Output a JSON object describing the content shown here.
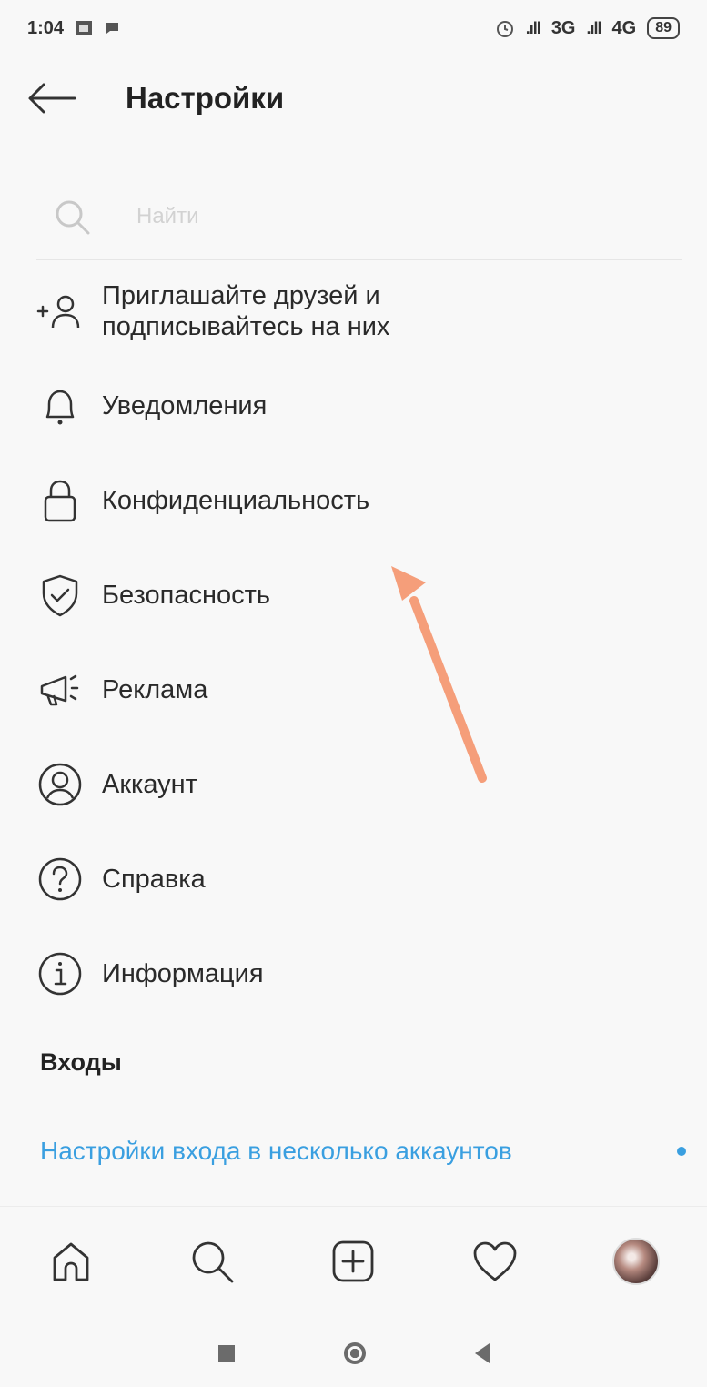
{
  "status_bar": {
    "time": "1:04",
    "network1": "3G",
    "network2": "4G",
    "battery": "89"
  },
  "header": {
    "title": "Настройки"
  },
  "search": {
    "placeholder": "Найти"
  },
  "menu": {
    "items": [
      {
        "label": "Приглашайте друзей и подписывайтесь на них",
        "icon": "add-person-icon"
      },
      {
        "label": "Уведомления",
        "icon": "bell-icon"
      },
      {
        "label": "Конфиденциальность",
        "icon": "lock-icon"
      },
      {
        "label": "Безопасность",
        "icon": "shield-check-icon"
      },
      {
        "label": "Реклама",
        "icon": "megaphone-icon"
      },
      {
        "label": "Аккаунт",
        "icon": "user-circle-icon"
      },
      {
        "label": "Справка",
        "icon": "help-circle-icon"
      },
      {
        "label": "Информация",
        "icon": "info-circle-icon"
      }
    ]
  },
  "logins": {
    "section_title": "Входы",
    "multi_login_label": "Настройки входа в несколько аккаунтов"
  },
  "colors": {
    "accent": "#3a9fe0",
    "annotation_arrow": "#f59e7a"
  }
}
